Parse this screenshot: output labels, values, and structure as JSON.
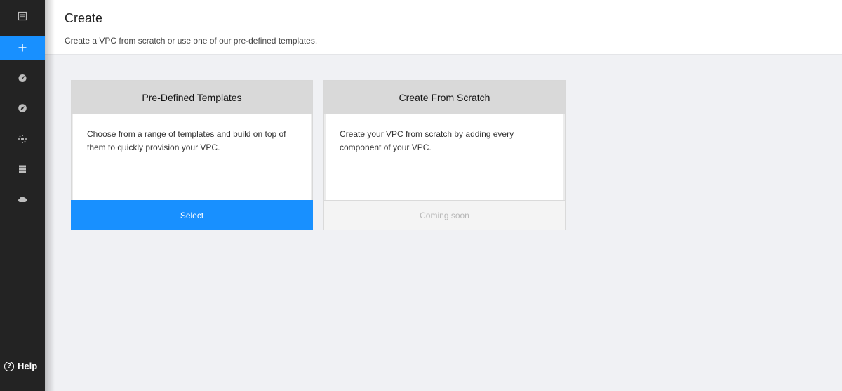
{
  "sidebar": {
    "items": [
      {
        "icon": "list-icon",
        "active": false
      },
      {
        "icon": "plus-icon",
        "active": true
      },
      {
        "icon": "dashboard-icon",
        "active": false
      },
      {
        "icon": "compass-icon",
        "active": false
      },
      {
        "icon": "network-icon",
        "active": false
      },
      {
        "icon": "server-icon",
        "active": false
      },
      {
        "icon": "cloud-icon",
        "active": false
      }
    ],
    "help_label": "Help",
    "help_glyph": "?"
  },
  "header": {
    "title": "Create",
    "subtitle": "Create a VPC from scratch or use one of our pre-defined templates."
  },
  "cards": [
    {
      "title": "Pre-Defined Templates",
      "description": "Choose from a range of templates and build on top of them to quickly provision your VPC.",
      "action_label": "Select"
    },
    {
      "title": "Create From Scratch",
      "description": "Create your VPC from scratch by adding every component of your VPC.",
      "action_label": "Coming soon"
    }
  ],
  "colors": {
    "sidebar_bg": "#232323",
    "accent": "#1890ff",
    "card_header_bg": "#d9d9d9"
  }
}
